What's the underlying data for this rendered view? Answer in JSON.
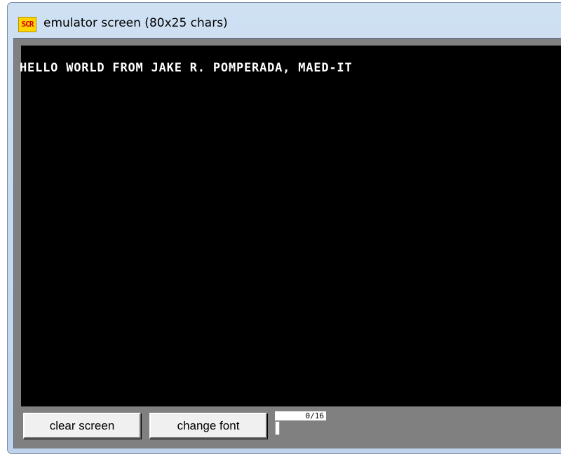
{
  "window": {
    "title": "emulator screen (80x25 chars)",
    "icon": {
      "name": "emu8086-app-icon",
      "text": "SCR"
    }
  },
  "screen": {
    "lines": [
      "HELLO WORLD FROM JAKE R. POMPERADA, MAED-IT"
    ],
    "background": "#000000",
    "foreground": "#ffffff"
  },
  "controls": {
    "clear_label": "clear screen",
    "font_label": "change font",
    "counter": "0/16",
    "slider_position": 0
  }
}
